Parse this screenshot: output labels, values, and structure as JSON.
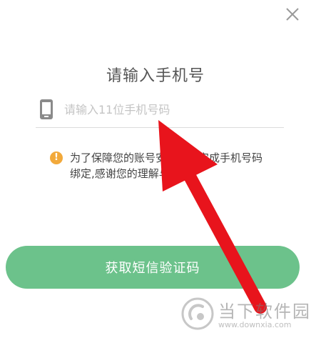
{
  "dialog": {
    "title": "请输入手机号",
    "phone_placeholder": "请输入11位手机号码",
    "phone_value": "",
    "notice_text": "为了保障您的账号安全，请完成手机号码绑定,感谢您的理解与支持。",
    "submit_label": "获取短信验证码"
  },
  "icons": {
    "close": "close-icon",
    "phone": "phone-icon",
    "warning": "warning-icon",
    "warning_symbol": "!",
    "annotation": "red-arrow"
  },
  "watermark": {
    "site_name": "当下软件园",
    "url": "www.downxia.com"
  },
  "colors": {
    "primary_button": "#6cc28b",
    "warning": "#f2a93b",
    "annotation_arrow": "#e8141c",
    "text": "#444444",
    "placeholder": "#c4c4c4"
  }
}
